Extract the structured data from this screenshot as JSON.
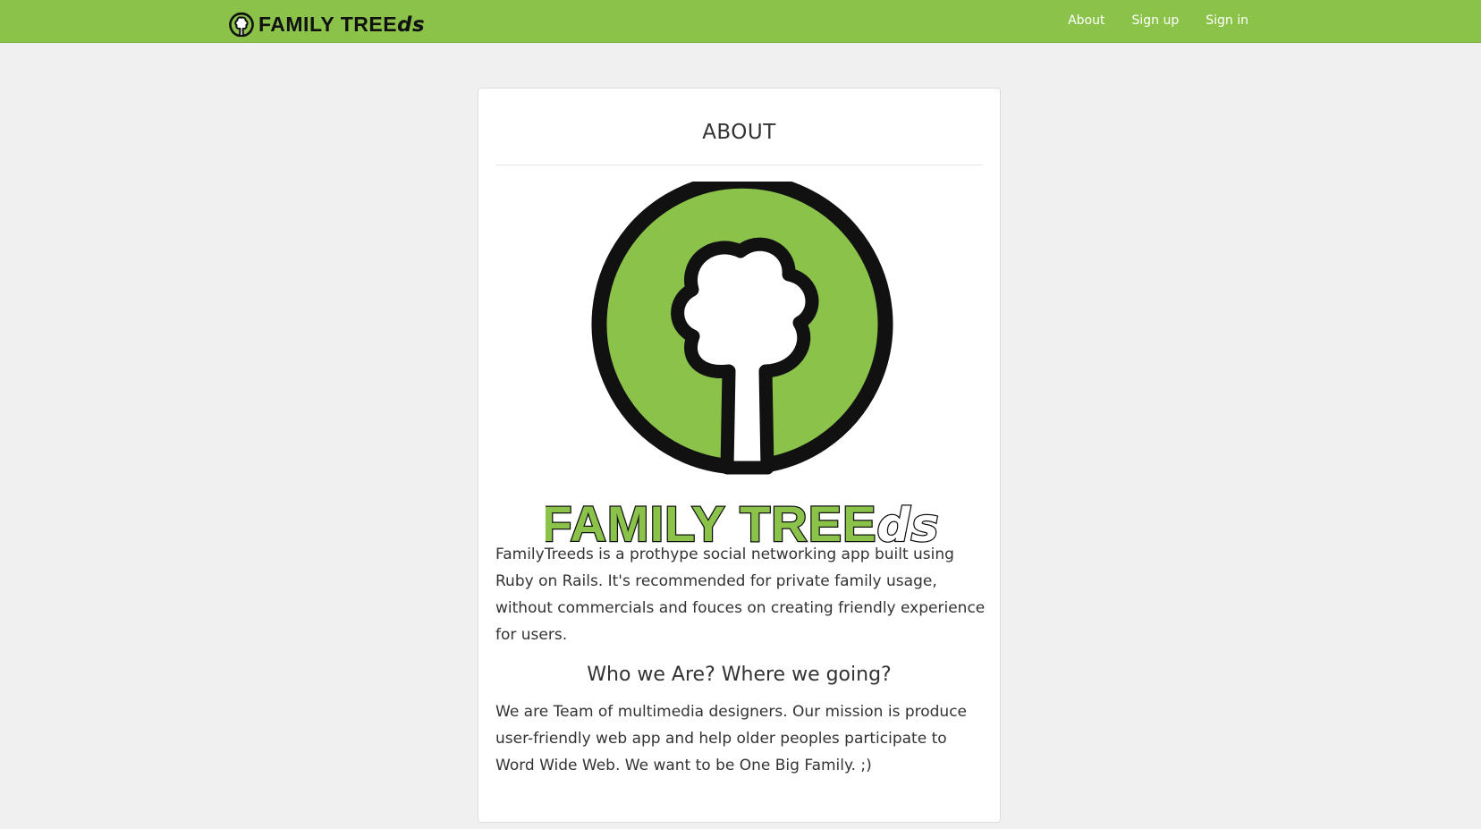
{
  "navbar": {
    "brand_main": "FAMILY TREE",
    "brand_suffix": "ds",
    "links": [
      {
        "label": "About"
      },
      {
        "label": "Sign up"
      },
      {
        "label": "Sign in"
      }
    ]
  },
  "card": {
    "title": "ABOUT",
    "logo": {
      "icon": "tree-icon",
      "wordmark_main": "FAMILY TREE",
      "wordmark_suffix": "ds"
    },
    "intro": "FamilyTreeds is a prothype social networking app built using Ruby on Rails. It's recommended for private family usage, without commercials and fouces on creating friendly experience for users.",
    "subheading": "Who we Are? Where we going?",
    "mission": "We are Team of multimedia designers. Our mission is produce user-friendly web app and help older peoples participate to Word Wide Web. We want to be One Big Family. ;)"
  },
  "colors": {
    "brand_green": "#8bc34a",
    "background": "#f0f0f0",
    "text": "#333333"
  }
}
